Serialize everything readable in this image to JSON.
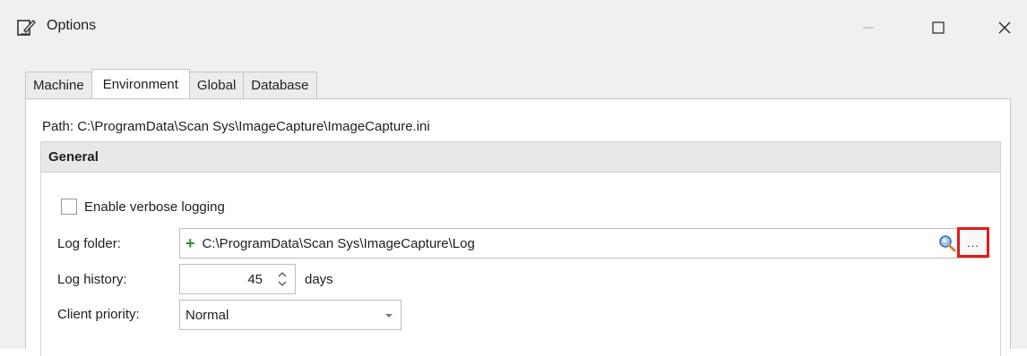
{
  "window": {
    "title": "Options",
    "icon": "notepad-pen-icon",
    "controls": [
      "minimize-icon",
      "maximize-icon",
      "close-icon"
    ]
  },
  "tabs": [
    {
      "label": "Machine",
      "active": false
    },
    {
      "label": "Environment",
      "active": true
    },
    {
      "label": "Global",
      "active": false
    },
    {
      "label": "Database",
      "active": false
    }
  ],
  "path": {
    "text": "Path:  C:\\ProgramData\\Scan Sys\\ImageCapture\\ImageCapture.ini"
  },
  "group": {
    "title": "General"
  },
  "verbose_logging": {
    "label": "Enable verbose logging",
    "checked": false
  },
  "log_folder": {
    "label": "Log folder:",
    "value": "C:\\ProgramData\\Scan Sys\\ImageCapture\\Log",
    "browse_label": "...",
    "highlight_color": "#e21b1b"
  },
  "log_history": {
    "label": "Log history:",
    "value": "45",
    "unit": "days"
  },
  "client_priority": {
    "label": "Client priority:",
    "value": "Normal"
  }
}
